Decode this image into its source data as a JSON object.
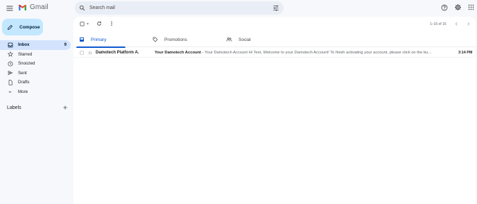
{
  "header": {
    "app_name": "Gmail",
    "search_placeholder": "Search mail",
    "brand_colors": [
      "#ea4335",
      "#fbbc04",
      "#34a853",
      "#4285f4",
      "#c5221f"
    ],
    "icons": [
      "menu-icon",
      "search-icon",
      "search-options-icon",
      "help-icon",
      "settings-icon",
      "apps-grid-icon"
    ]
  },
  "compose": {
    "label": "Compose",
    "icon": "pencil-icon"
  },
  "sidebar": {
    "items": [
      {
        "label": "Inbox",
        "count": "9",
        "icon": "inbox-icon",
        "active": true
      },
      {
        "label": "Starred",
        "icon": "star-icon"
      },
      {
        "label": "Snoozed",
        "icon": "clock-icon"
      },
      {
        "label": "Sent",
        "icon": "send-icon"
      },
      {
        "label": "Drafts",
        "icon": "draft-icon"
      },
      {
        "label": "More",
        "icon": "chevron-down-icon"
      }
    ],
    "labels_title": "Labels"
  },
  "toolbar": {
    "pagination": "1–16 of 16"
  },
  "tabs": [
    {
      "label": "Primary",
      "icon": "inbox-icon",
      "active": true
    },
    {
      "label": "Promotions",
      "icon": "tag-icon"
    },
    {
      "label": "Social",
      "icon": "people-icon"
    }
  ],
  "emails": [
    {
      "sender": "Damotech Platform A.",
      "subject": "Your Damotech Account",
      "snippet": " - Your Damotech Account Hi Test, Welcome to your Damotech Account! To finish activating your account, please click on the bu...",
      "time": "3:14 PM",
      "unread": true
    }
  ],
  "colors": {
    "accent": "#0b57d0",
    "compose_bg": "#c2e7ff",
    "active_nav_bg": "#d3e3fd",
    "page_bg": "#f6f8fc"
  }
}
